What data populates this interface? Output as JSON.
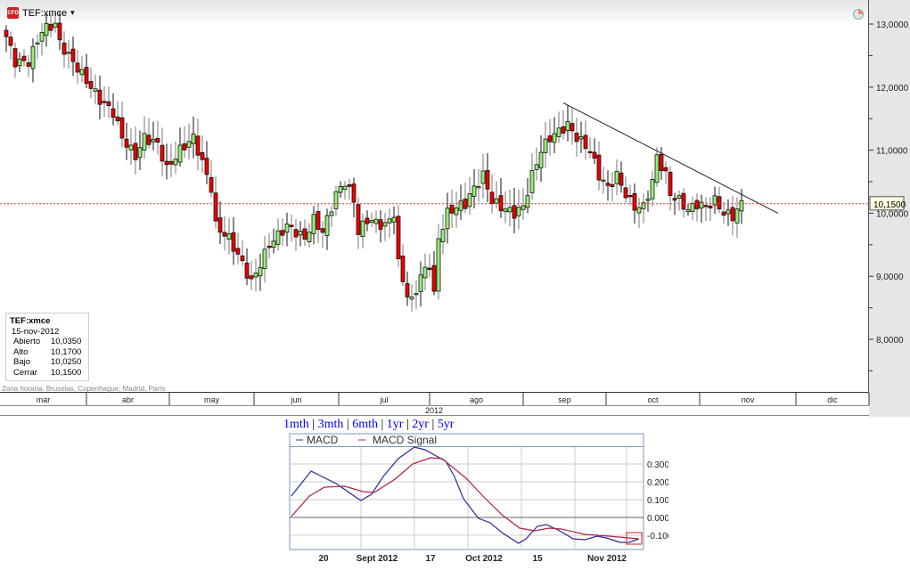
{
  "header": {
    "badge": "CFD",
    "symbol": "TEF:xmce",
    "dropdown": "▾"
  },
  "info_box": {
    "symbol": "TEF:xmce",
    "date": "15-nov-2012",
    "rows": [
      {
        "label": "Abierto",
        "value": "10,0350"
      },
      {
        "label": "Alto",
        "value": "10,1700"
      },
      {
        "label": "Bajo",
        "value": "10,0250"
      },
      {
        "label": "Cerrar",
        "value": "10,1500"
      }
    ]
  },
  "timezone": "Zona horaria: Bruselas, Copenhague, Madrid, París",
  "periods": [
    "1mth",
    "3mth",
    "6mth",
    "1yr",
    "2yr",
    "5yr"
  ],
  "colors": {
    "up": "#99ee77",
    "down": "#ee0000",
    "macd": "#2a2a99",
    "signal": "#aa2244"
  },
  "chart_data": [
    {
      "type": "candlestick",
      "title": "TEF:xmce",
      "ylim": [
        7.2,
        13.4
      ],
      "yticks": [
        {
          "v": 13,
          "label": "13,0000"
        },
        {
          "v": 12,
          "label": "12,0000"
        },
        {
          "v": 11,
          "label": "11,0000"
        },
        {
          "v": 10,
          "label": "10,0000"
        },
        {
          "v": 9,
          "label": "9,0000"
        },
        {
          "v": 8,
          "label": "8,0000"
        }
      ],
      "current_price": {
        "value": 10.15,
        "label": "10,1500"
      },
      "months": [
        "mar",
        "abr",
        "may",
        "jun",
        "jul",
        "ago",
        "sep",
        "oct",
        "nov",
        "dic"
      ],
      "year_label": "2012",
      "close_waypoints": [
        [
          0,
          12.8
        ],
        [
          2,
          12.4
        ],
        [
          5,
          12.4
        ],
        [
          8,
          12.9
        ],
        [
          11,
          13.0
        ],
        [
          12,
          12.7
        ],
        [
          15,
          12.4
        ],
        [
          19,
          12.0
        ],
        [
          21,
          11.8
        ],
        [
          24,
          11.6
        ],
        [
          26,
          11.2
        ],
        [
          29,
          10.9
        ],
        [
          31,
          11.2
        ],
        [
          34,
          11.1
        ],
        [
          36,
          10.7
        ],
        [
          39,
          11.0
        ],
        [
          42,
          11.2
        ],
        [
          44,
          10.8
        ],
        [
          46,
          10.4
        ],
        [
          47,
          9.8
        ],
        [
          50,
          9.6
        ],
        [
          53,
          9.2
        ],
        [
          55,
          8.9
        ],
        [
          57,
          9.2
        ],
        [
          59,
          9.5
        ],
        [
          63,
          9.8
        ],
        [
          67,
          9.6
        ],
        [
          69,
          9.9
        ],
        [
          71,
          9.7
        ],
        [
          74,
          10.3
        ],
        [
          76,
          10.5
        ],
        [
          78,
          10.2
        ],
        [
          79,
          9.7
        ],
        [
          81,
          9.9
        ],
        [
          83,
          9.85
        ],
        [
          85,
          9.8
        ],
        [
          87,
          10.0
        ],
        [
          88,
          9.2
        ],
        [
          90,
          8.7
        ],
        [
          91,
          8.6
        ],
        [
          93,
          9.0
        ],
        [
          95,
          9.2
        ],
        [
          96,
          8.7
        ],
        [
          97,
          9.6
        ],
        [
          99,
          10.0
        ],
        [
          101,
          10.1
        ],
        [
          103,
          10.15
        ],
        [
          105,
          10.4
        ],
        [
          107,
          10.6
        ],
        [
          109,
          10.2
        ],
        [
          111,
          10.1
        ],
        [
          114,
          10.0
        ],
        [
          116,
          10.1
        ],
        [
          118,
          10.6
        ],
        [
          120,
          11.0
        ],
        [
          122,
          11.2
        ],
        [
          124,
          11.3
        ],
        [
          126,
          11.4
        ],
        [
          128,
          11.2
        ],
        [
          131,
          11.0
        ],
        [
          133,
          10.6
        ],
        [
          135,
          10.4
        ],
        [
          137,
          10.6
        ],
        [
          139,
          10.3
        ],
        [
          141,
          10.1
        ],
        [
          143,
          10.1
        ],
        [
          145,
          10.5
        ],
        [
          146,
          10.9
        ],
        [
          148,
          10.6
        ],
        [
          149,
          10.3
        ],
        [
          151,
          10.2
        ],
        [
          153,
          10.05
        ],
        [
          155,
          10.15
        ],
        [
          157,
          10.1
        ],
        [
          159,
          10.2
        ],
        [
          161,
          10.0
        ],
        [
          163,
          9.95
        ],
        [
          165,
          10.15
        ]
      ],
      "trendline": [
        [
          125,
          11.75
        ],
        [
          172,
          10.0
        ]
      ]
    },
    {
      "type": "line",
      "title": "MACD",
      "legend": [
        "MACD",
        "MACD Signal"
      ],
      "ylim": [
        -0.18,
        0.4
      ],
      "yticks": [
        {
          "v": 0.3,
          "label": "0.300"
        },
        {
          "v": 0.2,
          "label": "0.200"
        },
        {
          "v": 0.1,
          "label": "0.100"
        },
        {
          "v": 0,
          "label": "0.000"
        },
        {
          "v": -0.1,
          "label": "-0.100"
        }
      ],
      "xticks": [
        {
          "d": 3,
          "label": "20"
        },
        {
          "d": 13,
          "label": "Sept 2012"
        },
        {
          "d": 23,
          "label": "17"
        },
        {
          "d": 33,
          "label": "Oct 2012"
        },
        {
          "d": 43,
          "label": "15"
        },
        {
          "d": 56,
          "label": "Nov 2012"
        }
      ],
      "series": [
        {
          "name": "MACD",
          "points": [
            [
              0.3,
              0.12
            ],
            [
              4,
              0.26
            ],
            [
              8.7,
              0.19
            ],
            [
              13.3,
              0.095
            ],
            [
              15.3,
              0.13
            ],
            [
              17.5,
              0.23
            ],
            [
              20.3,
              0.33
            ],
            [
              23.3,
              0.395
            ],
            [
              25.3,
              0.38
            ],
            [
              29.2,
              0.315
            ],
            [
              30.8,
              0.23
            ],
            [
              32.5,
              0.105
            ],
            [
              35.3,
              -0.005
            ],
            [
              37.5,
              -0.03
            ],
            [
              39.7,
              -0.085
            ],
            [
              42.8,
              -0.145
            ],
            [
              44.2,
              -0.12
            ],
            [
              46.3,
              -0.05
            ],
            [
              48,
              -0.04
            ],
            [
              50.2,
              -0.07
            ],
            [
              53,
              -0.12
            ],
            [
              55.2,
              -0.125
            ],
            [
              57.5,
              -0.105
            ],
            [
              59.2,
              -0.115
            ],
            [
              61.8,
              -0.14
            ],
            [
              63.5,
              -0.14
            ],
            [
              65.3,
              -0.12
            ]
          ]
        },
        {
          "name": "MACD Signal",
          "points": [
            [
              0.3,
              0.005
            ],
            [
              3.7,
              0.12
            ],
            [
              6.5,
              0.17
            ],
            [
              10.3,
              0.175
            ],
            [
              13.7,
              0.145
            ],
            [
              15.8,
              0.14
            ],
            [
              19.7,
              0.215
            ],
            [
              23,
              0.3
            ],
            [
              26.3,
              0.335
            ],
            [
              28.5,
              0.33
            ],
            [
              33,
              0.22
            ],
            [
              36.3,
              0.115
            ],
            [
              39.7,
              0.015
            ],
            [
              43,
              -0.06
            ],
            [
              45.8,
              -0.075
            ],
            [
              48.5,
              -0.06
            ],
            [
              50.8,
              -0.065
            ],
            [
              55.2,
              -0.095
            ],
            [
              59.7,
              -0.105
            ],
            [
              65.3,
              -0.12
            ]
          ]
        }
      ]
    }
  ]
}
